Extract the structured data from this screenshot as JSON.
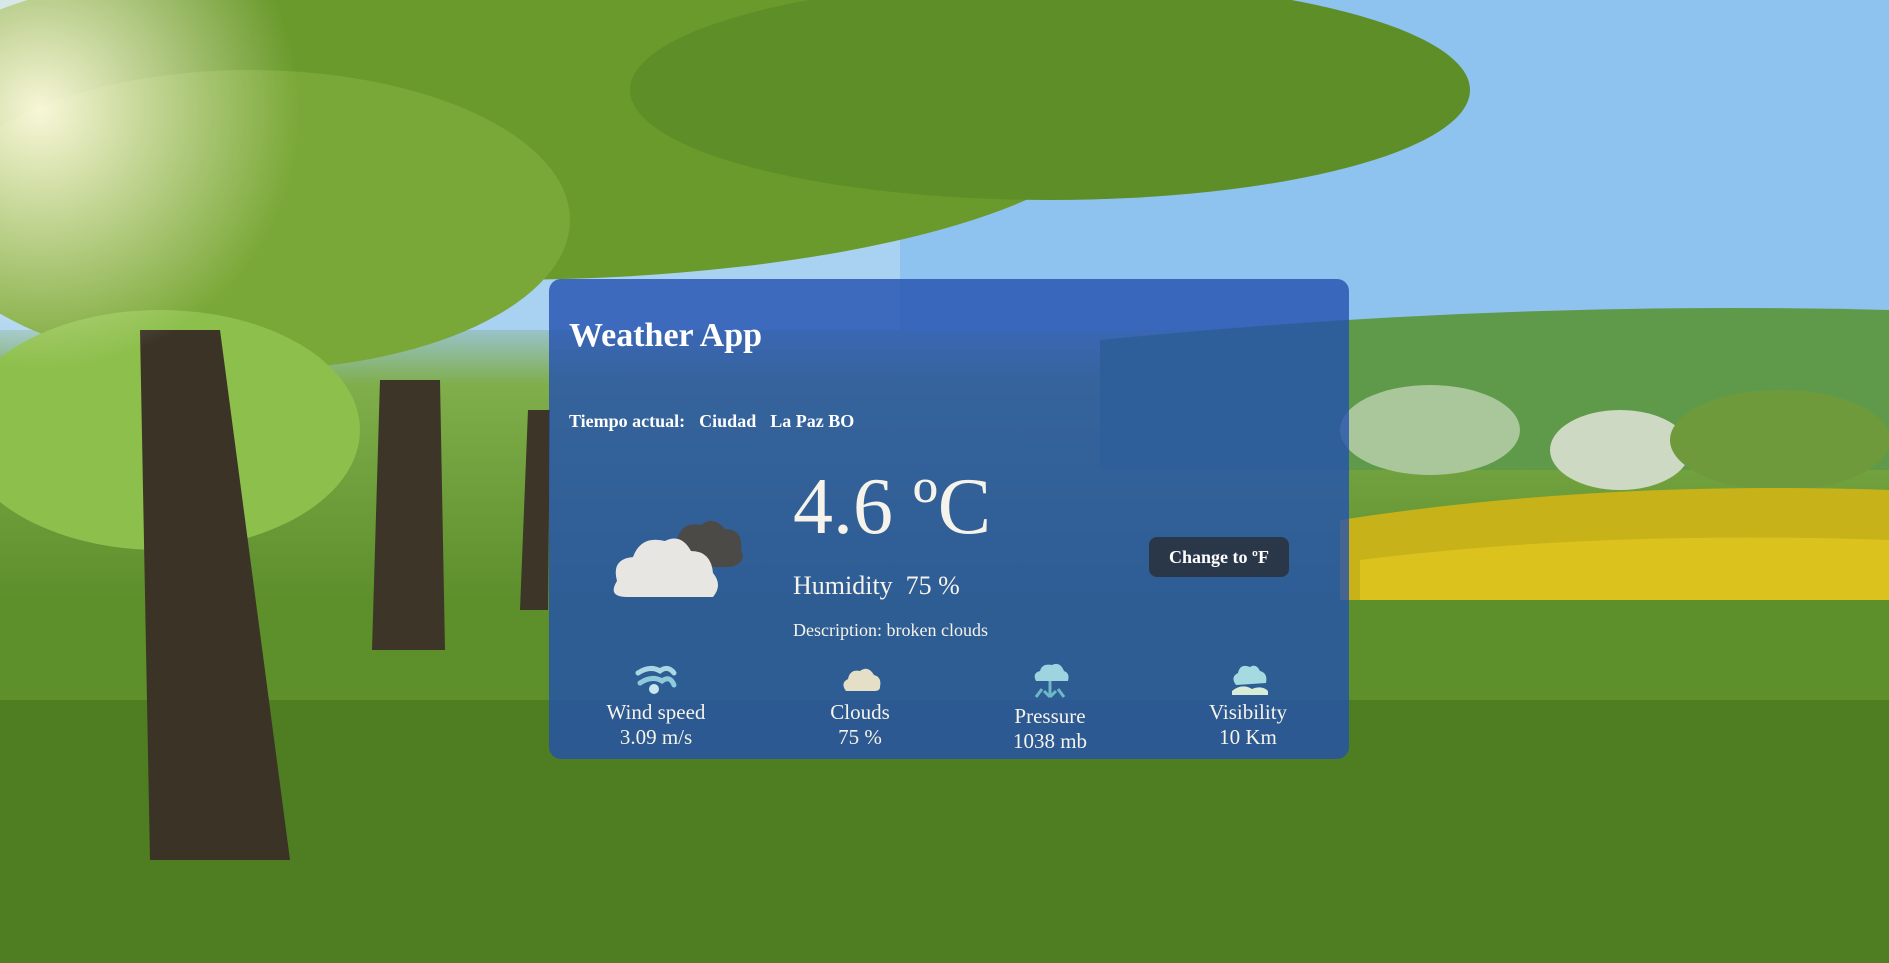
{
  "app": {
    "title": "Weather App"
  },
  "location": {
    "label": "Tiempo actual:",
    "city_label": "Ciudad",
    "city": "La Paz BO"
  },
  "current": {
    "temperature": "4.6 ºC",
    "humidity_label": "Humidity",
    "humidity_value": "75 %",
    "description_label": "Description:",
    "description_value": "broken clouds",
    "icon": "broken-clouds-icon"
  },
  "toggle": {
    "label": "Change to ºF"
  },
  "stats": [
    {
      "icon": "wind-icon",
      "label": "Wind speed",
      "value": "3.09 m/s"
    },
    {
      "icon": "cloud-icon",
      "label": "Clouds",
      "value": "75 %"
    },
    {
      "icon": "pressure-icon",
      "label": "Pressure",
      "value": "1038 mb"
    },
    {
      "icon": "visibility-icon",
      "label": "Visibility",
      "value": "10 Km"
    }
  ],
  "colors": {
    "card": "#2350af",
    "button": "#28303c",
    "text": "#f5f3ea"
  }
}
